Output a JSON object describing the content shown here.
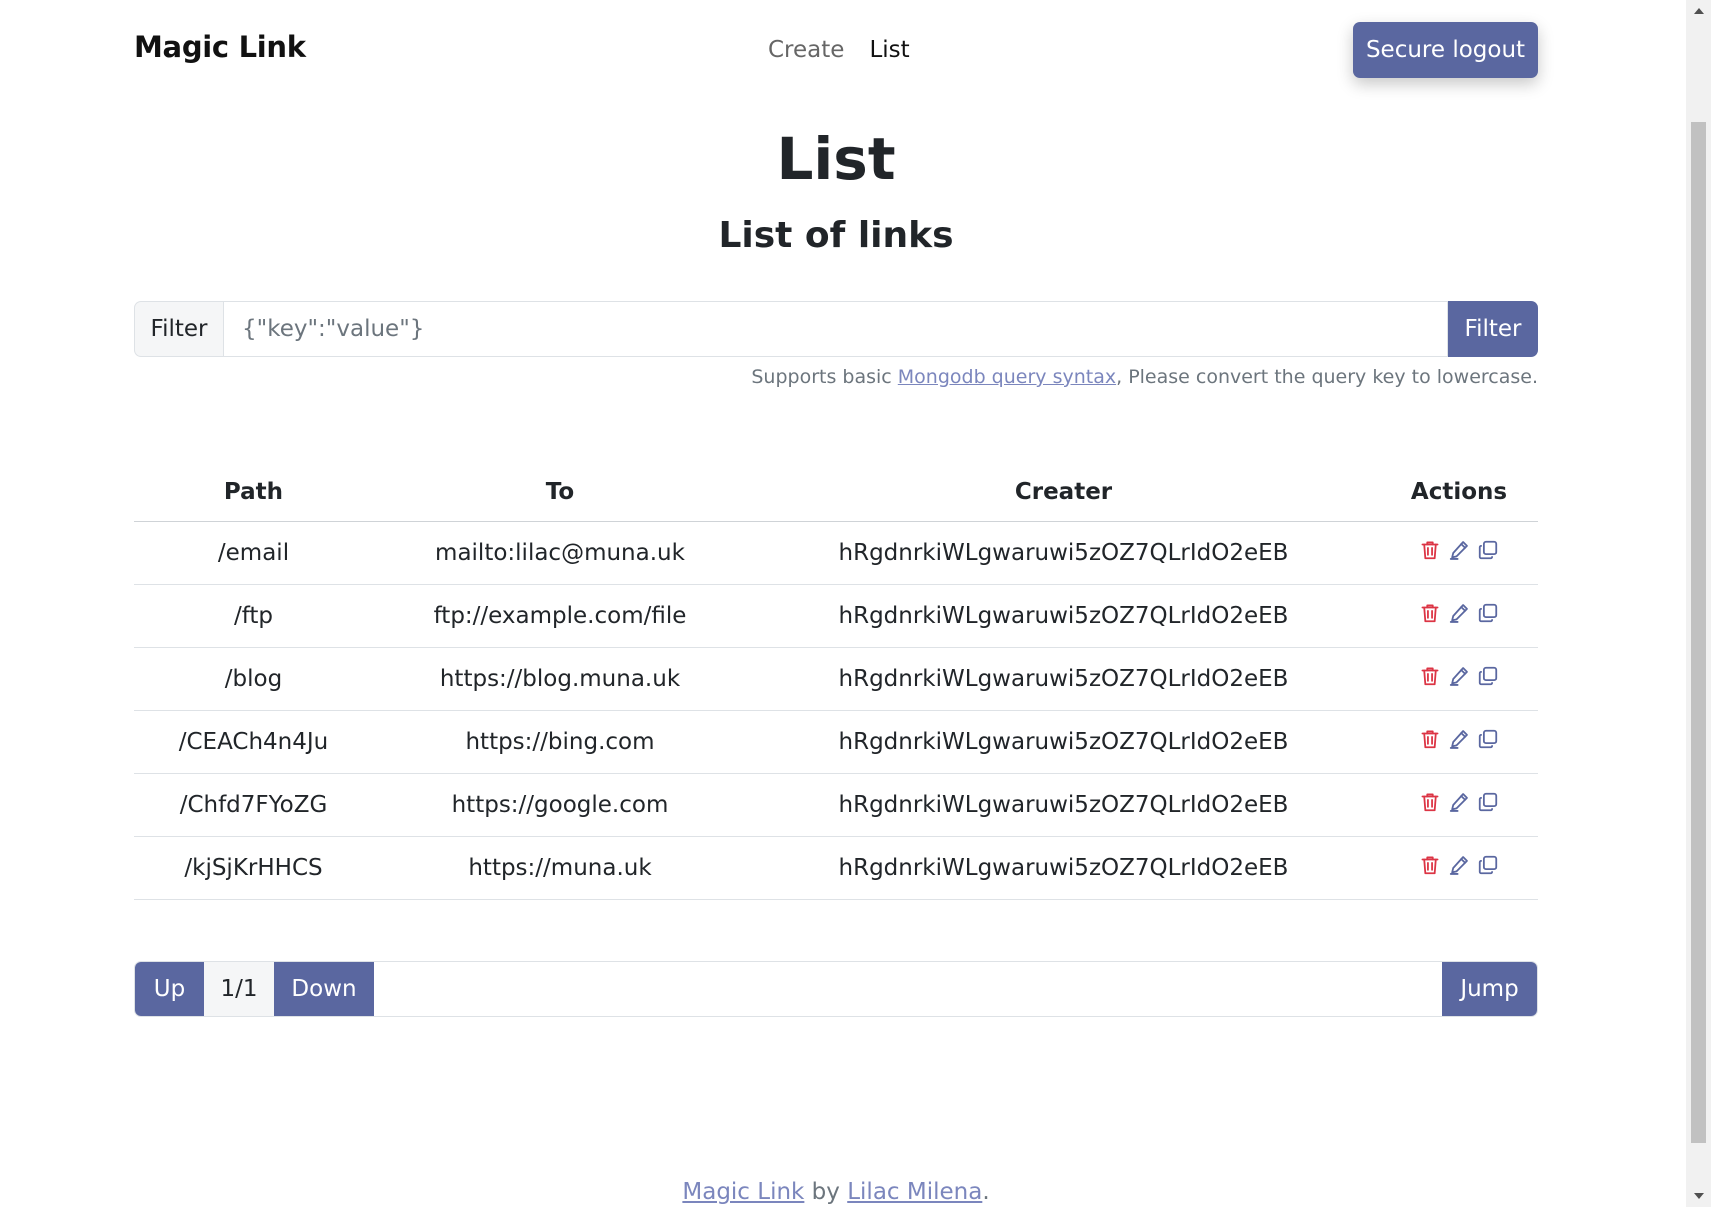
{
  "header": {
    "brand": "Magic Link",
    "nav": [
      {
        "label": "Create",
        "active": false
      },
      {
        "label": "List",
        "active": true
      }
    ],
    "logout_label": "Secure logout"
  },
  "main": {
    "title": "List",
    "subtitle": "List of links"
  },
  "filter": {
    "label": "Filter",
    "placeholder": "{\"key\":\"value\"}",
    "value": "",
    "button_label": "Filter",
    "help_prefix": "Supports basic ",
    "help_link": "Mongodb query syntax",
    "help_suffix": ", Please convert the query key to lowercase."
  },
  "table": {
    "headers": [
      "Path",
      "To",
      "Creater",
      "Actions"
    ],
    "rows": [
      {
        "path": "/email",
        "to": "mailto:lilac@muna.uk",
        "creater": "hRgdnrkiWLgwaruwi5zOZ7QLrIdO2eEB"
      },
      {
        "path": "/ftp",
        "to": "ftp://example.com/file",
        "creater": "hRgdnrkiWLgwaruwi5zOZ7QLrIdO2eEB"
      },
      {
        "path": "/blog",
        "to": "https://blog.muna.uk",
        "creater": "hRgdnrkiWLgwaruwi5zOZ7QLrIdO2eEB"
      },
      {
        "path": "/CEACh4n4Ju",
        "to": "https://bing.com",
        "creater": "hRgdnrkiWLgwaruwi5zOZ7QLrIdO2eEB"
      },
      {
        "path": "/Chfd7FYoZG",
        "to": "https://google.com",
        "creater": "hRgdnrkiWLgwaruwi5zOZ7QLrIdO2eEB"
      },
      {
        "path": "/kjSjKrHHCS",
        "to": "https://muna.uk",
        "creater": "hRgdnrkiWLgwaruwi5zOZ7QLrIdO2eEB"
      }
    ],
    "action_icons": [
      "trash-icon",
      "edit-icon",
      "copy-icon"
    ]
  },
  "pager": {
    "up_label": "Up",
    "page_indicator": "1/1",
    "down_label": "Down",
    "jump_input_value": "",
    "jump_label": "Jump"
  },
  "footer": {
    "app_link": "Magic Link",
    "by_text": " by ",
    "author_link": "Lilac Milena",
    "end_text": "."
  },
  "colors": {
    "primary": "#5a67a0",
    "danger": "#dc3545",
    "link": "#7b86bd"
  }
}
